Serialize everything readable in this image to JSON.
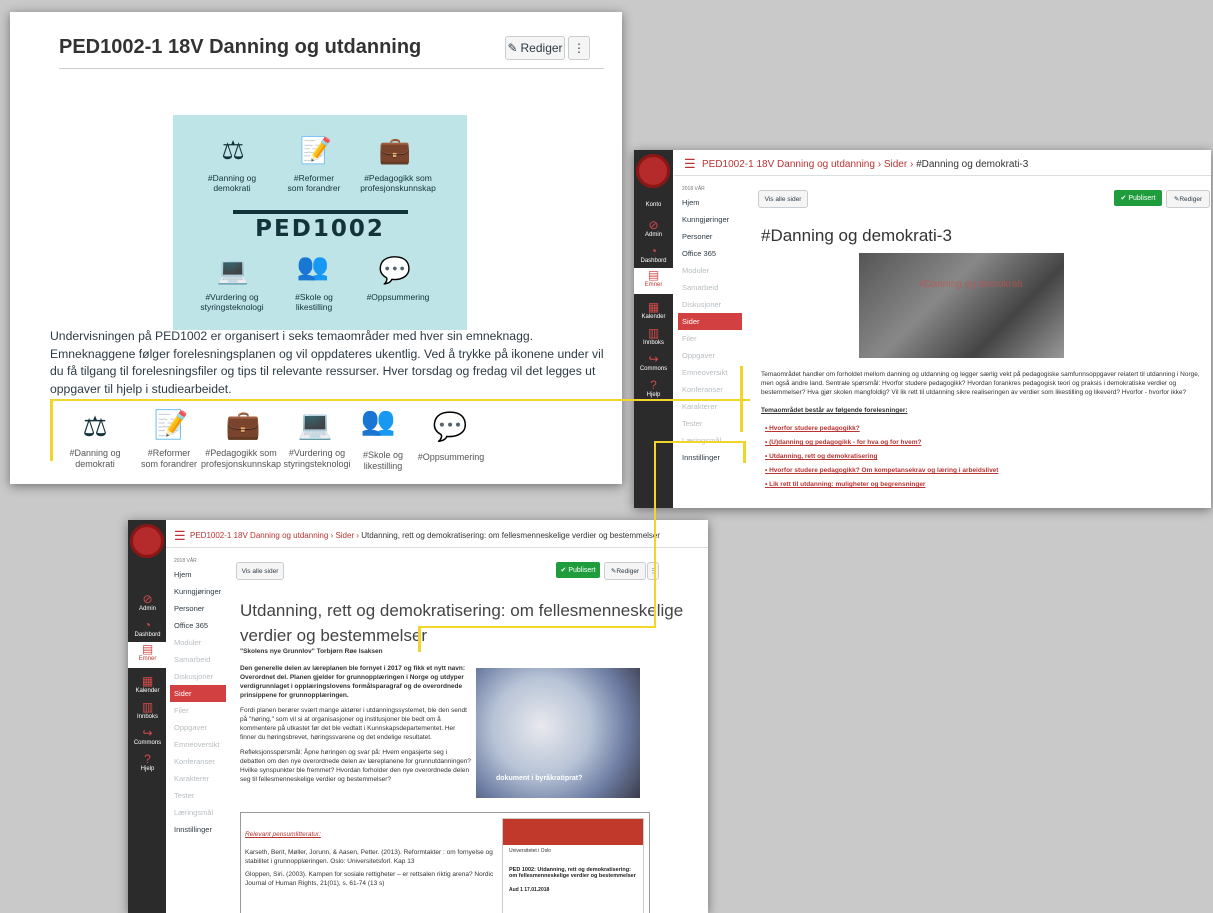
{
  "win1": {
    "title": "PED1002-1 18V Danning og utdanning",
    "edit_label": "Rediger",
    "more_label": "⋮",
    "banner": {
      "logo": "PED1002",
      "labels": [
        "#Danning og\ndemokrati",
        "#Reformer\nsom forandrer",
        "#Pedagogikk som\nprofesjonskunnskap",
        "#Vurdering og\nstyringsteknologi",
        "#Skole og\nlikestilling",
        "#Oppsummering"
      ]
    },
    "intro": "Undervisningen på PED1002 er organisert i seks temaområder med hver sin emneknagg. Emneknaggene følger forelesningsplanen og vil oppdateres ukentlig. Ved å trykke på ikonene under vil du få tilgang til forelesningsfiler og tips til relevante ressurser. Hver torsdag og fredag vil det legges ut oppgaver til hjelp i studiearbeidet.",
    "strip_labels": [
      "#Danning og\ndemokrati",
      "#Reformer\nsom forandrer",
      "#Pedagogikk som\nprofesjonskunnskap",
      "#Vurdering og\nstyringsteknologi",
      "#Skole og\nlikestilling",
      "#Oppsummering"
    ]
  },
  "win2": {
    "crumb_course": "PED1002-1 18V Danning og utdanning",
    "crumb_sider": "Sider",
    "crumb_page": "#Danning og demokrati-3",
    "term": "2018 VÅR",
    "nav": [
      {
        "label": "Hjem",
        "dim": false
      },
      {
        "label": "Kunngjøringer",
        "dim": false
      },
      {
        "label": "Personer",
        "dim": false
      },
      {
        "label": "Office 365",
        "dim": false
      },
      {
        "label": "Moduler",
        "dim": true
      },
      {
        "label": "Samarbeid",
        "dim": true
      },
      {
        "label": "Diskusjoner",
        "dim": true
      },
      {
        "label": "Sider",
        "dim": false,
        "active": true
      },
      {
        "label": "Filer",
        "dim": true
      },
      {
        "label": "Oppgaver",
        "dim": true
      },
      {
        "label": "Emneoversikt",
        "dim": true
      },
      {
        "label": "Konferanser",
        "dim": true
      },
      {
        "label": "Karakterer",
        "dim": true
      },
      {
        "label": "Tester",
        "dim": true
      },
      {
        "label": "Læringsmål",
        "dim": true
      },
      {
        "label": "Innstillinger",
        "dim": false
      }
    ],
    "global_nav": [
      "Konto",
      "Admin",
      "Dashbord",
      "Emner",
      "Kalender",
      "Innboks",
      "Commons",
      "Hjelp"
    ],
    "vis_alle": "Vis alle sider",
    "publisert": "Publisert",
    "rediger": "Rediger",
    "heading": "#Danning og demokrati-3",
    "image_caption": "#Danning og demokrati",
    "body": "Temaområdet handler om forholdet mellom danning og utdanning og legger særlig vekt på pedagogiske samfunnsoppgaver relatert til utdanning i Norge, men også andre land. Sentrale spørsmål: Hvorfor studere pedagogikk? Hvordan forankres pedagogisk teori og praksis i demokratiske verdier og bestemmelser? Hva gjør skolen mangfoldig? Vil lik rett til utdanning sikre realiseringen av verdier som likestilling og likeverd? Hvorfor - hvorfor ikke?",
    "list_head": "Temaområdet består av følgende forelesninger:",
    "links": [
      "Hvorfor studere pedagogikk?",
      "(U)danning og pedagogikk - for hva og for hvem?",
      "Utdanning, rett og demokratisering",
      "Hvorfor studere pedagogikk? Om kompetansekrav og læring i arbeidslivet",
      "Lik rett til utdanning: muligheter og begrensninger"
    ]
  },
  "win3": {
    "crumb_course": "PED1002-1 18V Danning og utdanning",
    "crumb_sider": "Sider",
    "crumb_page": "Utdanning, rett og demokratisering: om fellesmenneskelige verdier og bestemmelser",
    "term": "2018 VÅR",
    "nav": [
      {
        "label": "Hjem",
        "dim": false
      },
      {
        "label": "Kunngjøringer",
        "dim": false
      },
      {
        "label": "Personer",
        "dim": false
      },
      {
        "label": "Office 365",
        "dim": false
      },
      {
        "label": "Moduler",
        "dim": true
      },
      {
        "label": "Samarbeid",
        "dim": true
      },
      {
        "label": "Diskusjoner",
        "dim": true
      },
      {
        "label": "Sider",
        "dim": false,
        "active": true
      },
      {
        "label": "Filer",
        "dim": true
      },
      {
        "label": "Oppgaver",
        "dim": true
      },
      {
        "label": "Emneoversikt",
        "dim": true
      },
      {
        "label": "Konferanser",
        "dim": true
      },
      {
        "label": "Karakterer",
        "dim": true
      },
      {
        "label": "Tester",
        "dim": true
      },
      {
        "label": "Læringsmål",
        "dim": true
      },
      {
        "label": "Innstillinger",
        "dim": false
      }
    ],
    "global_nav": [
      "Admin",
      "Dashbord",
      "Emner",
      "Kalender",
      "Innboks",
      "Commons",
      "Hjelp"
    ],
    "vis_alle": "Vis alle sider",
    "publisert": "Publisert",
    "rediger": "Rediger",
    "heading_1": "Utdanning, rett og demokratisering: om fellesmenneskelige",
    "heading_2": "verdier og bestemmelser",
    "subtitle": "\"Skolens nye Grunnlov\" Torbjørn Røe Isaksen",
    "para1": "Den generelle delen av læreplanen ble fornyet i 2017 og fikk et nytt navn: Overordnet del. Planen gjelder for grunnopplæringen i Norge og utdyper verdigrunnlaget i opplæringslovens formålsparagraf og de overordnede prinsippene for grunnopplæringen.",
    "para2": "Fordi planen berører svært mange aktører i utdanningssystemet, ble den sendt på \"høring,\" som vil si at organisasjoner og institusjoner ble bedt om å kommentere på utkastet før det ble vedtatt i Kunnskapsdepartementet. Her finner du høringsbrevet, høringssvarene og det endelige resultatet.",
    "para3": "Refleksjonsspørsmål: Åpne høringen og svar på: Hvem engasjerte seg i debatten om den nye overordnede delen av læreplanene for grunnutdanningen? Hvilke synspunkter ble fremmet? Hvordan forholder den nye overordnede delen seg til fellesmenneskelige verdier og bestemmelser?",
    "cartoon_caption": "dokument i byråkratiprat?",
    "lit_head": "Relevant pensumlitteratur:",
    "lit1": "Karseth, Berit, Møller, Jorunn, & Aasen, Petter. (2013). Reformtakter : om fornyelse og stabilitet i grunnopplæringen. Oslo: Universitetsforl. Kap 13",
    "lit2": "Gloppen, Siri. (2003). Kampen for sosiale rettigheter – er rettsalen riktig arena? Nordic Journal of Human Rights, 21(01), s. 61-74 (13 s)",
    "slide_org": "Universitetet i Oslo",
    "slide_title": "PED 1002: Utdanning, rett og demokratisering: om fellesmenneskelige verdier og bestemmelser",
    "slide_sub": "Aud 1 17.01.2018"
  }
}
